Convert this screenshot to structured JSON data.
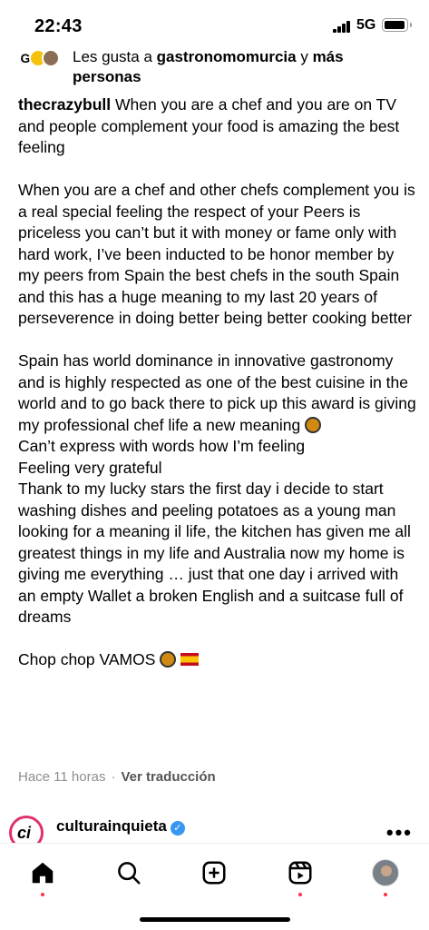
{
  "status": {
    "time": "22:43",
    "network": "5G"
  },
  "likes": {
    "prefix": "Les gusta a ",
    "user": "gastronomomurcia",
    "conj": " y ",
    "others": "más personas",
    "avatar_letter": "G"
  },
  "caption": {
    "user": "thecrazybull",
    "p1": " When you are a chef and you are on TV and people complement your food is amazing the best feeling",
    "p2": "When you are a chef and other chefs complement you is a real special feeling the respect of your Peers is priceless you can’t but it with money or fame only with hard work, I’ve been inducted to be honor member by my peers from Spain the best chefs in the south Spain and this has a huge meaning to my last 20 years of perseverence in doing better being better cooking better",
    "p3": "Spain has world dominance in innovative gastronomy and is highly respected as one of the best cuisine in the world and to go back there to pick up this award is giving my professional chef life a new meaning",
    "p4": "Can’t express with words how I’m feeling",
    "p5": "Feeling very grateful",
    "p6": "Thank to my lucky stars the first day i decide to start washing dishes and peeling potatoes as a young man looking for a meaning il life, the kitchen has given me all greatest things in my life and Australia now my home is giving me everything … just that one day i arrived with an empty Wallet a broken English and a suitcase full of dreams",
    "p7": "Chop chop VAMOS"
  },
  "meta": {
    "time_ago": "Hace 11 horas",
    "separator": "·",
    "translate": "Ver traducción"
  },
  "next_post": {
    "username": "culturainquieta",
    "avatar_text": "ci"
  },
  "icons": {
    "home": "home-icon",
    "search": "search-icon",
    "create": "plus-square-icon",
    "reels": "reels-icon",
    "profile": "profile-avatar"
  },
  "colors": {
    "notification": "#ff3040",
    "verified": "#3897f0",
    "story_ring": "#e1306c",
    "meta_text": "#8e8e8e"
  }
}
